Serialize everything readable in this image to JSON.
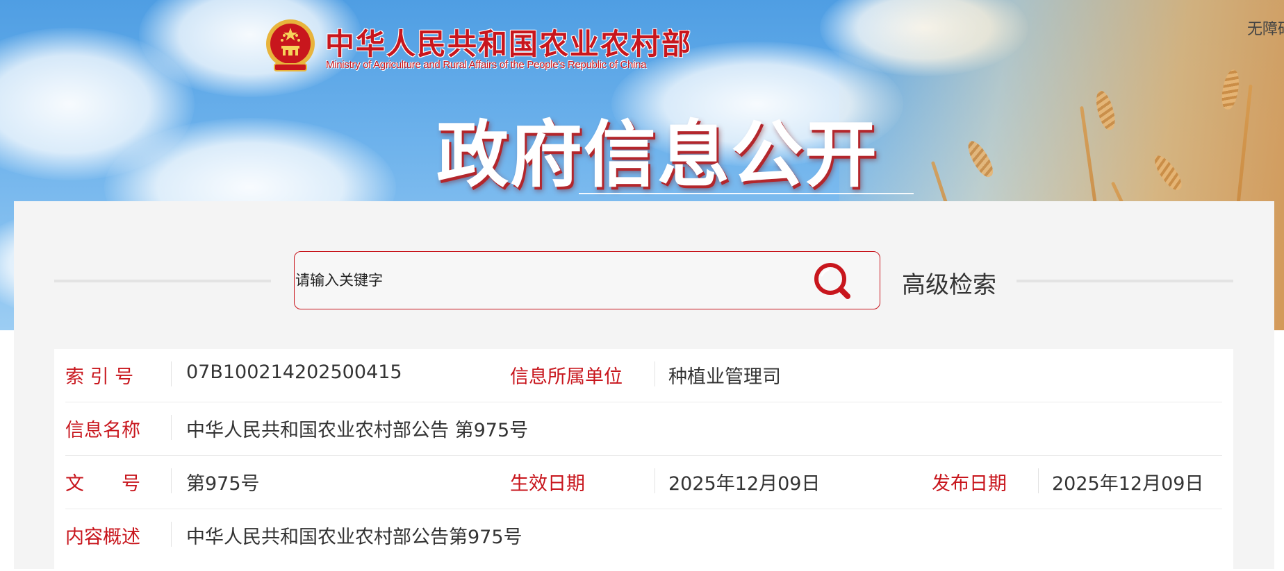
{
  "header": {
    "ministry_name_cn": "中华人民共和国农业农村部",
    "ministry_name_en": "Ministry of Agriculture and Rural Affairs of the People's Republic of China",
    "page_title": "政府信息公开",
    "accessibility_label": "无障碍"
  },
  "search": {
    "placeholder": "请输入关键字",
    "value": "",
    "advanced_label": "高级检索"
  },
  "info": {
    "index_no_label": "索 引 号",
    "index_no_value": "07B100214202500415",
    "unit_label": "信息所属单位",
    "unit_value": "种植业管理司",
    "name_label": "信息名称",
    "name_value": "中华人民共和国农业农村部公告 第975号",
    "doc_no_label": "文　　号",
    "doc_no_value": "第975号",
    "effective_label": "生效日期",
    "effective_value": "2025年12月09日",
    "publish_label": "发布日期",
    "publish_value": "2025年12月09日",
    "summary_label": "内容概述",
    "summary_value": "中华人民共和国农业农村部公告第975号"
  },
  "colors": {
    "accent_red": "#c8161d",
    "panel_bg": "#f4f4f4",
    "sky_blue": "#4f9ee3"
  },
  "icons": {
    "emblem": "national-emblem-icon",
    "search": "search-icon"
  }
}
